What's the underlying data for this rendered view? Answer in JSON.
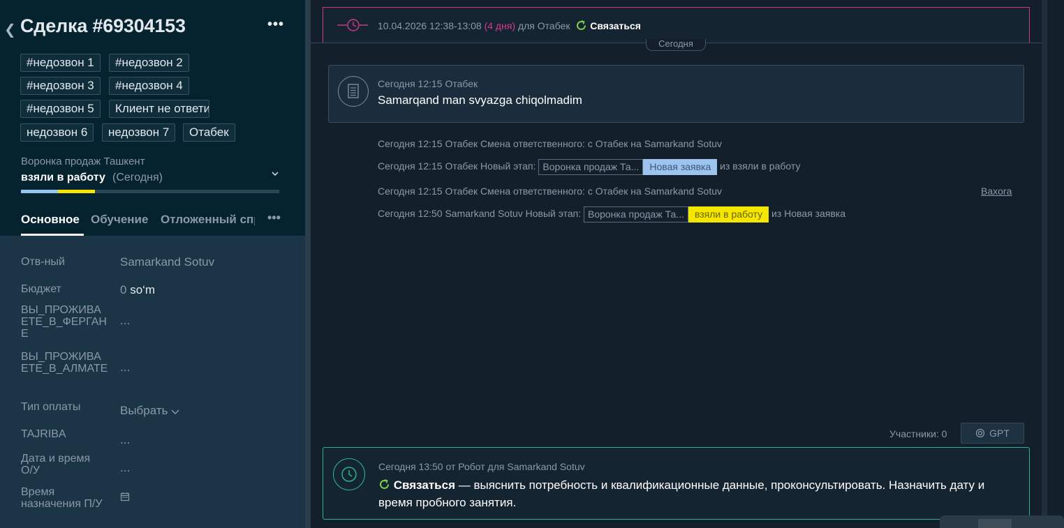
{
  "deal": {
    "title": "Сделка #69304153",
    "more": "•••"
  },
  "tags": [
    "#недозвон 1",
    "#недозвон 2",
    "#недозвон 3",
    "#недозвон 4",
    "#недозвон 5",
    "Клиент не ответи",
    "недозвон 6",
    "недозвон 7",
    "Отабек"
  ],
  "pipeline": {
    "name": "Воронка продаж Ташкент",
    "stage": "взяли в работу",
    "stage_date": "(Сегодня)",
    "progress_stages_filled": 2
  },
  "tabs": {
    "main": "Основное",
    "training": "Обучение",
    "deferred": "Отложенный спр",
    "more": "•••"
  },
  "fields": {
    "responsible_label": "Отв-ный",
    "responsible_value": "Samarkand Sotuv",
    "budget_label": "Бюджет",
    "budget_value": "0",
    "budget_currency": "so‘m",
    "fergana_label": "ВЫ_ПРОЖИВАЕТЕ_В_ФЕРГАНЕ",
    "fergana_value": "...",
    "almaty_label": "ВЫ_ПРОЖИВАЕТЕ_В_АЛМАТЕ",
    "almaty_value": "...",
    "payment_label": "Тип оплаты",
    "payment_value": "Выбрать",
    "tajriba_label": "TAJRIBA",
    "tajriba_value": "...",
    "datetime_label": "Дата и время О/У",
    "datetime_value": "...",
    "time_label": "Время назначения П/У"
  },
  "top_task": {
    "date": "10.04.2026 12:38-13:08",
    "overdue": "(4 дня)",
    "for": "для Отабек",
    "action": "Связаться"
  },
  "today_badge": "Сегодня",
  "note": {
    "meta": "Сегодня 12:15 Отабек",
    "body": "Samarqand man svyazga chiqolmadim"
  },
  "events": {
    "e1": "Сегодня 12:15 Отабек Смена ответственного: с Отабек на Samarkand Sotuv",
    "e2_prefix": "Сегодня 12:15 Отабек Новый этап:",
    "e2_pipeline": "Воронка продаж Та...",
    "e2_stage": "Новая заявка",
    "e2_suffix": "из взяли в работу",
    "e3": "Сегодня 12:15 Отабек Смена ответственного: с Отабек на Samarkand Sotuv",
    "e3_link": "Baxora",
    "e4_prefix": "Сегодня 12:50 Samarkand Sotuv Новый этап:",
    "e4_pipeline": "Воронка продаж Та...",
    "e4_stage": "взяли в работу",
    "e4_suffix": "из Новая заявка"
  },
  "participants": "Участники: 0",
  "gpt_label": "GPT",
  "bottom_task": {
    "meta": "Сегодня 13:50 от Робот для Samarkand Sotuv",
    "action": "Связаться",
    "text": " — выяснить потребность и квалификационные данные, проконсультировать. Назначить дату и время пробного занятия."
  },
  "colors": {
    "accent_pink": "#d43a8c",
    "accent_green": "#2bb58e",
    "stage_yellow": "#f5e600",
    "stage_blue": "#9cc4ef"
  }
}
